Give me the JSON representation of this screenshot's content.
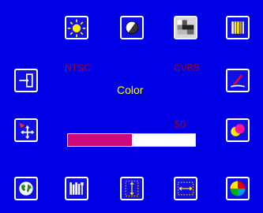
{
  "status": {
    "mode": "NTSC",
    "input": "CVBS"
  },
  "parameter": {
    "name": "Color",
    "value": "50",
    "level": 0.5
  },
  "colors": {
    "background": "#0000e6",
    "value_text": "#b40000",
    "param_name": "#ffff00",
    "slider_fill": "#cc0a7a",
    "slider_track": "#ffffff"
  },
  "icons": {
    "top_row": [
      "brightness-icon",
      "contrast-icon",
      "sharpness-icon",
      "color-bars-icon"
    ],
    "left_column": [
      "exit-icon",
      "position-icon",
      "language-icon"
    ],
    "right_column": [
      "tint-icon",
      "color-icon",
      "color-wheel-icon"
    ],
    "bottom_row": [
      "tools-icon",
      "vertical-size-icon",
      "horizontal-size-icon"
    ],
    "selected": "sharpness-icon"
  }
}
